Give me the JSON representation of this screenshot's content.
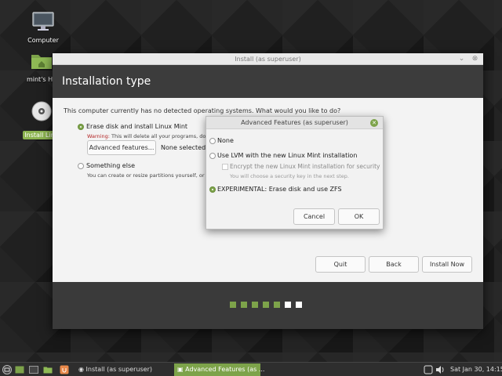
{
  "desktop": {
    "icons": [
      {
        "label": "Computer"
      },
      {
        "label": "mint's Ho"
      },
      {
        "label": "Install Linu"
      }
    ]
  },
  "window": {
    "title": "Install (as superuser)",
    "heading": "Installation type",
    "question": "This computer currently has no detected operating systems. What would you like to do?",
    "erase_label": "Erase disk and install Linux Mint",
    "warning_prefix": "Warning:",
    "warning_text": " This will delete all your programs, doc",
    "advanced_button": "Advanced features...",
    "none_selected": "None selected",
    "something_else_label": "Something else",
    "something_else_hint": "You can create or resize partitions yourself, or c",
    "quit_button": "Quit",
    "back_button": "Back",
    "install_button": "Install Now",
    "progress": {
      "completed_steps": 6,
      "total_steps": 8
    }
  },
  "dialog": {
    "title": "Advanced Features (as superuser)",
    "none_label": "None",
    "lvm_label": "Use LVM with the new Linux Mint installation",
    "encrypt_label": "Encrypt the new Linux Mint installation for security",
    "encrypt_hint": "You will choose a security key in the next step.",
    "zfs_label": "EXPERIMENTAL: Erase disk and use ZFS",
    "cancel_button": "Cancel",
    "ok_button": "OK"
  },
  "taskbar": {
    "items": [
      {
        "label": "Install (as superuser)"
      },
      {
        "label": "Advanced Features (as ..."
      }
    ],
    "clock": "Sat Jan 30, 14:15"
  },
  "colors": {
    "accent": "#7da34a",
    "header": "#3c3c3c"
  }
}
